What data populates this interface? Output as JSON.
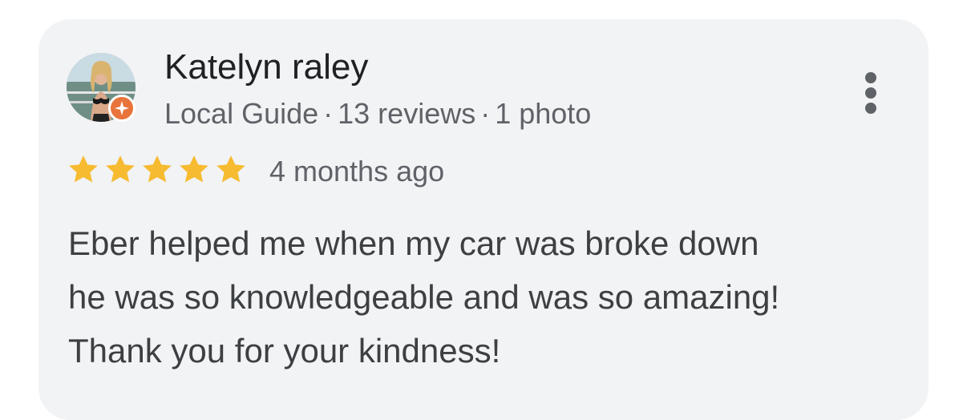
{
  "review": {
    "author_name": "Katelyn raley",
    "author_meta": {
      "level": "Local Guide",
      "reviews": "13 reviews",
      "photos": "1 photo",
      "separator": "·"
    },
    "rating": 5,
    "rating_max": 5,
    "date": "4 months ago",
    "text_lines": [
      "Eber helped me when my car was broke down",
      "he was so knowledgeable and was so amazing!",
      "Thank you for your kindness!"
    ]
  },
  "icons": {
    "avatar": "user-avatar-photo",
    "badge": "local-guide-badge-icon",
    "star": "star-icon",
    "more": "more-vert-icon"
  },
  "colors": {
    "card_background": "#f2f3f5",
    "star": "#f6bb30",
    "guide_badge": "#e8743b",
    "name": "#202124",
    "secondary_text": "#5f6368",
    "body_text": "#3c4043"
  }
}
